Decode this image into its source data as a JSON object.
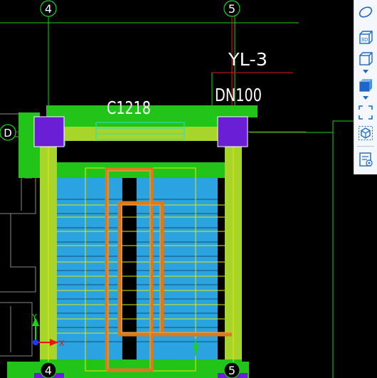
{
  "drawing": {
    "axis_labels": {
      "top_left": "4",
      "top_right": "5",
      "bottom_left": "4",
      "bottom_right": "5",
      "row_left": "D"
    },
    "window_label": "C1218",
    "riser_label": "YL-3",
    "pipe_label": "DN100",
    "ucs": {
      "y_axis": "Y",
      "x_axis": "X"
    }
  },
  "toolbar": {
    "buttons": [
      {
        "name": "view-sphere",
        "icon": "orbit-icon"
      },
      {
        "name": "view-3d",
        "icon": "3d-cube-icon",
        "label": "3D"
      },
      {
        "name": "view-box",
        "icon": "box-view-icon"
      },
      {
        "name": "view-box-blue",
        "icon": "shaded-box-icon"
      },
      {
        "name": "zoom-extents",
        "icon": "zoom-extents-icon"
      },
      {
        "name": "isolate",
        "icon": "isolate-cube-icon"
      },
      {
        "name": "properties",
        "icon": "properties-view-icon"
      }
    ]
  },
  "colors": {
    "background": "#000000",
    "wall_green": "#22c41a",
    "beam_yellow_green": "#a8d52a",
    "column_purple": "#6a1fd6",
    "stair_blue": "#2aa3e0",
    "handrail_orange": "#d97a1e",
    "axis_red": "#e01818",
    "axis_green": "#19d219"
  }
}
